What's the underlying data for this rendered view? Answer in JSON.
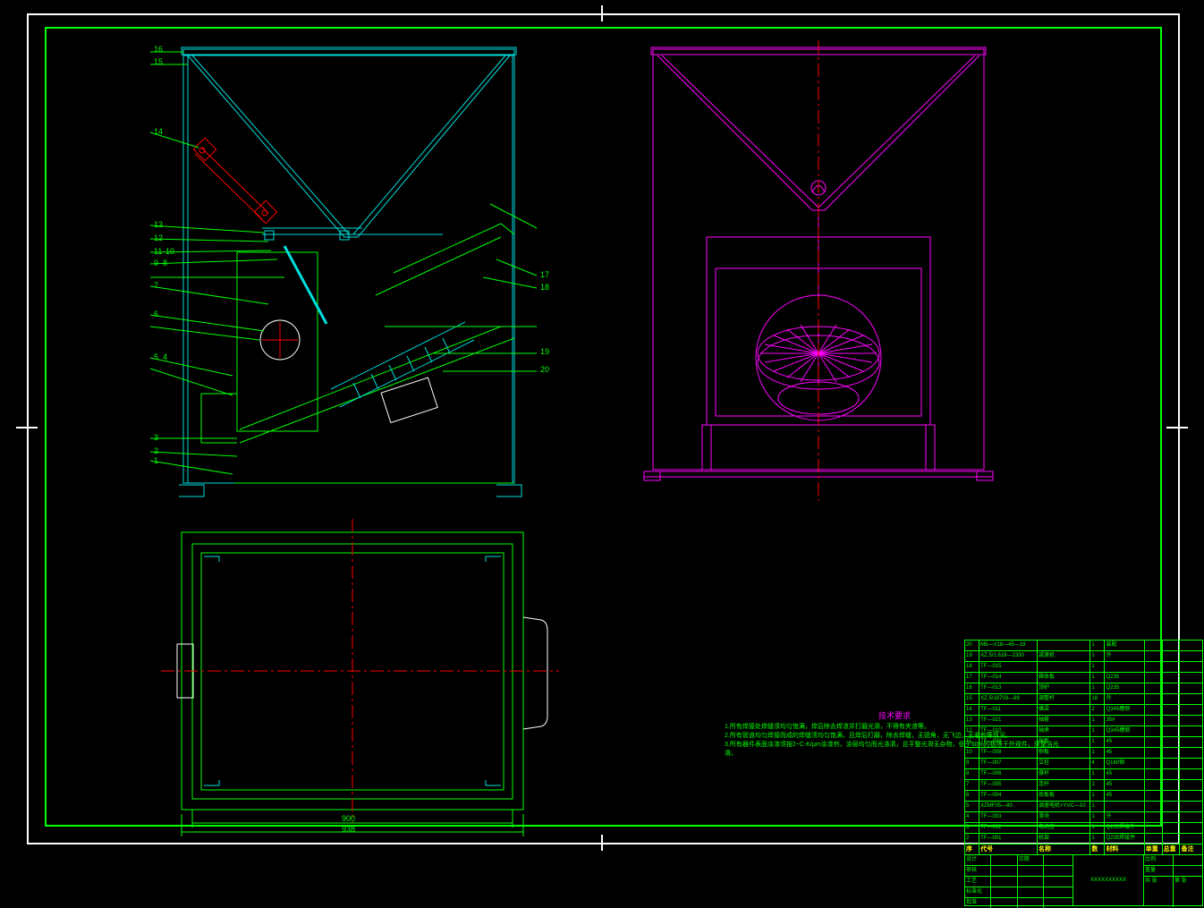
{
  "callouts": {
    "left_view": [
      "1",
      "2",
      "3",
      "4",
      "5",
      "6",
      "7",
      "8",
      "9",
      "10",
      "11",
      "12",
      "13",
      "14",
      "15",
      "16",
      "17",
      "18",
      "19",
      "20"
    ]
  },
  "notes": {
    "title": "技术要求",
    "lines": [
      "1.所有焊接处焊缝须均匀饱满，焊后除去焊渣并打磨光滑，不得有夹渣等。",
      "2.所有管道均匀焊接而成的焊缝须均匀饱满，且焊后打磨，除去焊缝，无锐角，无飞边，无毛刺等情况。",
      "3.所有器件表面涂漆须按2~C-K/μm涂漆剂，涂层均匀而光涤清，且平整光滑无杂物，低于50%的极限于外观件，须整洁光滑。"
    ]
  },
  "bom": {
    "headers": [
      "序号",
      "代号",
      "名称",
      "数量",
      "材料",
      "单重",
      "总重",
      "备注"
    ],
    "rows": [
      {
        "no": "20",
        "code": "M5—V18—45—19",
        "name": "",
        "qty": "1",
        "mat": "装配"
      },
      {
        "no": "19",
        "code": "XZ.5/1.618—2330",
        "name": "减速机",
        "qty": "1",
        "mat": "外"
      },
      {
        "no": "18",
        "code": "TF—015",
        "name": "",
        "qty": "1",
        "mat": ""
      },
      {
        "no": "17",
        "code": "TF—014",
        "name": "箱体板",
        "qty": "1",
        "mat": "Q235"
      },
      {
        "no": "16",
        "code": "TF—013",
        "name": "顶护",
        "qty": "1",
        "mat": "Q235"
      },
      {
        "no": "15",
        "code": "XZ.5/18703—89",
        "name": "调整杆",
        "qty": "18",
        "mat": "外"
      },
      {
        "no": "14",
        "code": "TF—011",
        "name": "横梁",
        "qty": "2",
        "mat": "Q345槽钢"
      },
      {
        "no": "13",
        "code": "TF—021",
        "name": "轴套",
        "qty": "1",
        "mat": "35#"
      },
      {
        "no": "12",
        "code": "TF—010",
        "name": "轴承",
        "qty": "1",
        "mat": "Q345槽钢"
      },
      {
        "no": "11",
        "code": "TF—009",
        "name": "挡板",
        "qty": "1",
        "mat": "45"
      },
      {
        "no": "10",
        "code": "TF—008",
        "name": "侧板",
        "qty": "1",
        "mat": "45"
      },
      {
        "no": "9",
        "code": "TF—007",
        "name": "立柱",
        "qty": "4",
        "mat": "Q160钢"
      },
      {
        "no": "8",
        "code": "TF—006",
        "name": "撑杆",
        "qty": "1",
        "mat": "45"
      },
      {
        "no": "7",
        "code": "TF—005",
        "name": "连杆",
        "qty": "1",
        "mat": "45"
      },
      {
        "no": "6",
        "code": "TF—004",
        "name": "底板板",
        "qty": "1",
        "mat": "45"
      },
      {
        "no": "5",
        "code": "XZMF05—80",
        "name": "调速电机×YVC—10",
        "qty": "1",
        "mat": ""
      },
      {
        "no": "4",
        "code": "TF—003",
        "name": "滑块",
        "qty": "1",
        "mat": "外"
      },
      {
        "no": "3",
        "code": "TF—002",
        "name": "电机座",
        "qty": "1",
        "mat": "Q235焊接件"
      },
      {
        "no": "2",
        "code": "TF—001",
        "name": "机架",
        "qty": "1",
        "mat": "Q235焊接件"
      }
    ]
  },
  "titleblock": {
    "drawing_title": "XXXXXXXXXX",
    "fields": [
      "设计",
      "审核",
      "工艺",
      "标准化",
      "批准",
      "日期",
      "比例",
      "重量",
      "共 张",
      "第 张"
    ]
  },
  "dims": {
    "bottom_width": "900",
    "bottom_width2": "938"
  }
}
